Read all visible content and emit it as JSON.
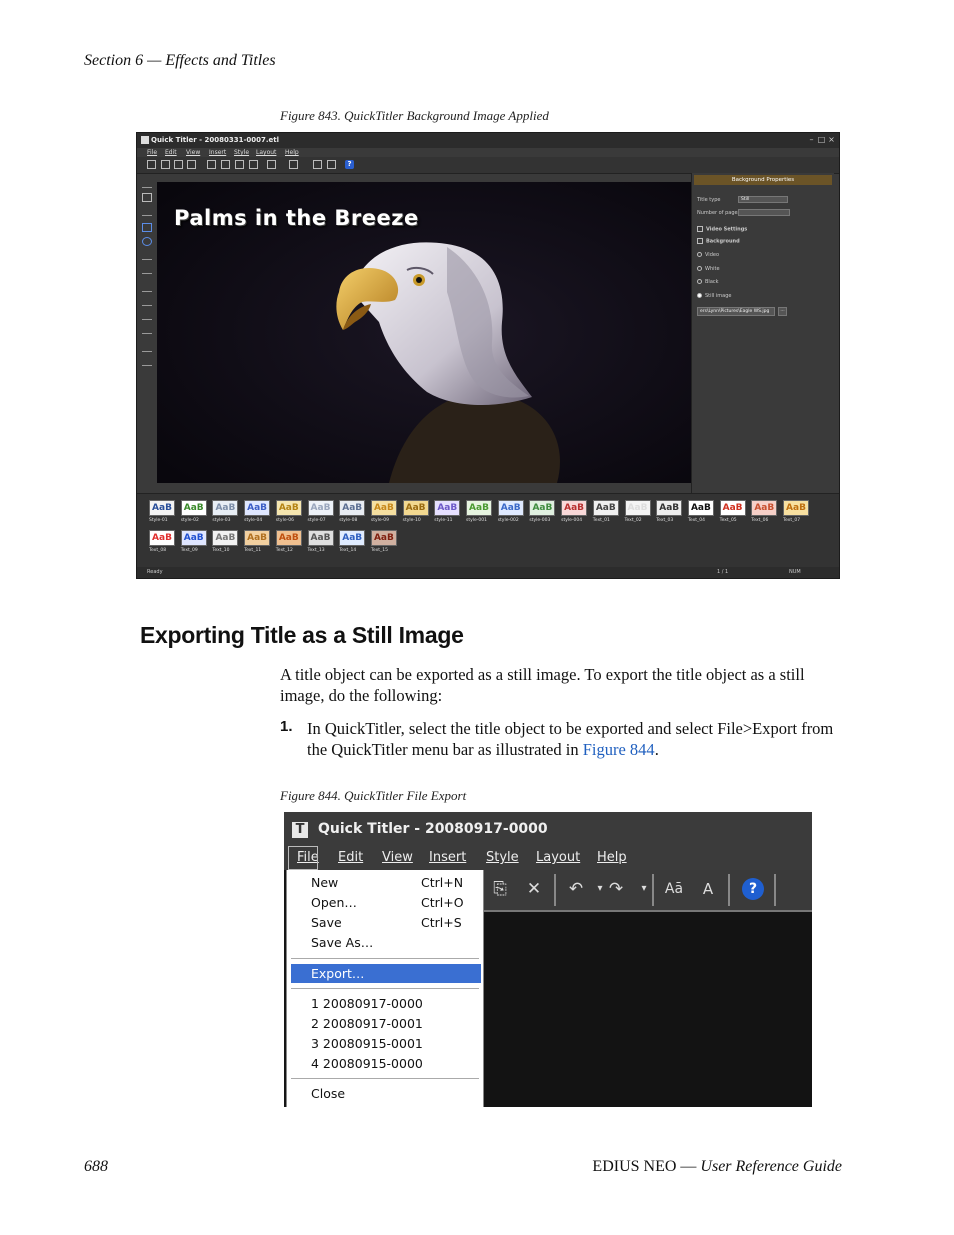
{
  "page": {
    "header": "Section 6 — Effects and Titles",
    "footer_page": "688",
    "footer_product": "EDIUS NEO",
    "footer_sep": "—",
    "footer_guide": "User Reference Guide"
  },
  "figure843": {
    "caption": "Figure 843.  QuickTitler Background Image Applied",
    "window_title": "Quick Titler - 20080331-0007.etl",
    "menu": [
      "File",
      "Edit",
      "View",
      "Insert",
      "Style",
      "Layout",
      "Help"
    ],
    "canvas_title": "Palms in the Breeze",
    "properties": {
      "header": "Background Properties",
      "title_type_label": "Title type",
      "title_type_value": "Still",
      "pages_label": "Number of pages",
      "video_settings": "Video Settings",
      "background": "Background",
      "options": [
        "Video",
        "White",
        "Black",
        "Still image"
      ],
      "selected_option": "Still image",
      "image_path": "ers\\Lynn\\Pictures\\Eagle WS.jpg",
      "browse": "..."
    },
    "styles_row1": [
      "Style-01",
      "style-02",
      "style-03",
      "style-04",
      "style-06",
      "style-07",
      "style-08",
      "style-09",
      "style-10",
      "style-11",
      "style-001",
      "style-002",
      "style-003",
      "style-004",
      "Text_01",
      "Text_02",
      "Text_03",
      "Text_04",
      "Text_05",
      "Text_06",
      "Text_07"
    ],
    "styles_row2": [
      "Text_08",
      "Text_09",
      "Text_10",
      "Text_11",
      "Text_12",
      "Text_13",
      "Text_14",
      "Text_15"
    ],
    "swatch_text": "AaB",
    "status": {
      "left": "Ready",
      "page": "1 / 1",
      "mode": "NUM"
    }
  },
  "section": {
    "heading": "Exporting Title as a Still Image",
    "intro": "A title object can be exported as a still image. To export the title object as a still image, do the following:",
    "step_number": "1.",
    "step_text_before": "In QuickTitler, select the title object to be exported and select File>Export from the QuickTitler menu bar as illustrated in ",
    "step_link": "Figure 844",
    "step_text_after": "."
  },
  "figure844": {
    "caption": "Figure 844.  QuickTitler File Export",
    "window_title": "Quick Titler - 20080917-0000",
    "menubar": [
      "File",
      "Edit",
      "View",
      "Insert",
      "Style",
      "Layout",
      "Help"
    ],
    "file_menu": {
      "new": "New",
      "new_sc": "Ctrl+N",
      "open": "Open…",
      "open_sc": "Ctrl+O",
      "save": "Save",
      "save_sc": "Ctrl+S",
      "save_as": "Save As…",
      "export": "Export…",
      "recent": [
        "1 20080917-0000",
        "2 20080917-0001",
        "3 20080915-0001",
        "4 20080915-0000"
      ],
      "close": "Close"
    }
  }
}
